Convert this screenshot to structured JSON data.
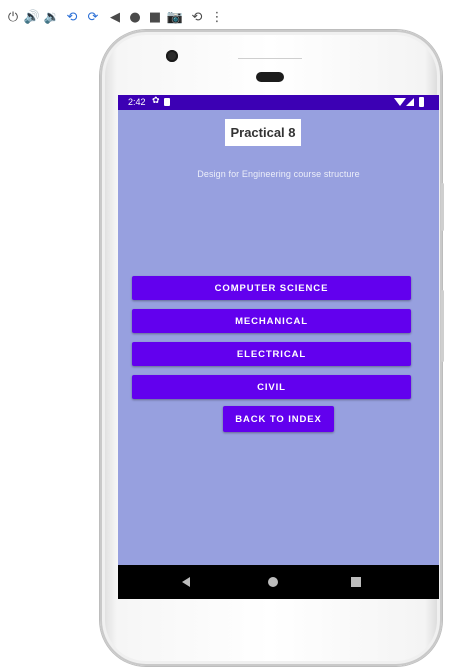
{
  "toolbar": {
    "icons": [
      "power-icon",
      "volume-up-icon",
      "volume-down-icon",
      "rotate-left-icon",
      "rotate-right-icon",
      "back-icon",
      "home-icon",
      "overview-icon",
      "camera-icon",
      "snapshot-icon",
      "more-icon"
    ],
    "glyphs": {
      "power": "⏻",
      "volume_up": "🔊",
      "volume_down": "🔉",
      "rotate_left": "⟲",
      "rotate_right": "⟳",
      "back": "◀",
      "home": "●",
      "overview": "■",
      "camera": "📷",
      "snapshot": "⟲",
      "more": "⋮"
    }
  },
  "status_bar": {
    "time": "2:42",
    "gear_glyph": "✿"
  },
  "app": {
    "title": "Practical 8",
    "subtitle": "Design for Engineering course structure",
    "buttons": [
      "COMPUTER SCIENCE",
      "MECHANICAL",
      "ELECTRICAL",
      "CIVIL"
    ],
    "back_label": "BACK TO INDEX"
  },
  "colors": {
    "status_bar": "#3c00b4",
    "screen_background": "#97a0df",
    "button": "#6200ee",
    "nav_bar": "#000000"
  }
}
